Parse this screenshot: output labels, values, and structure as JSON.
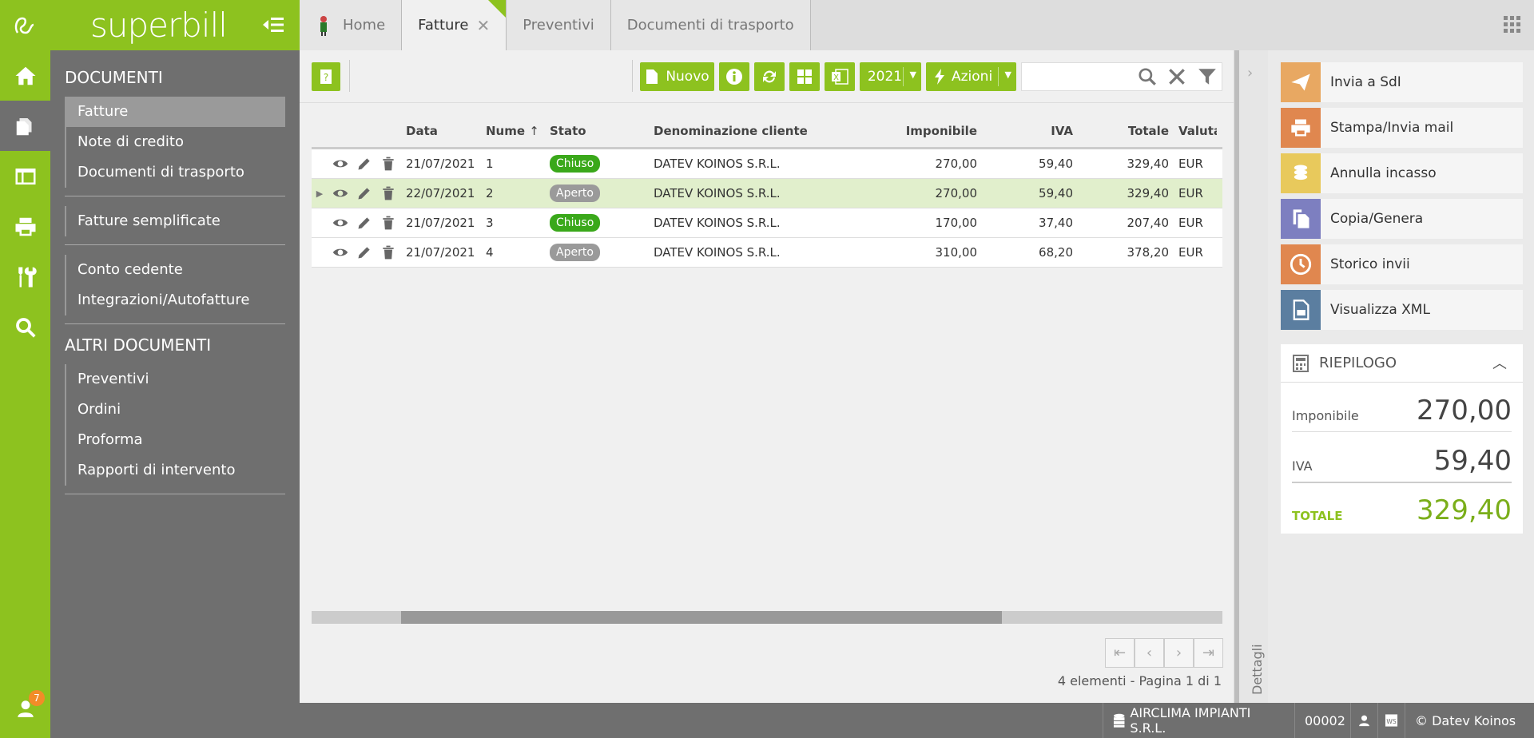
{
  "app": {
    "brand": "superbill"
  },
  "rail": {
    "items": [
      "home-icon",
      "documents-icon",
      "table-icon",
      "printer-icon",
      "tools-icon",
      "search-icon"
    ],
    "user_badge": "7"
  },
  "sidebar": {
    "section1_title": "DOCUMENTI",
    "group1": [
      "Fatture",
      "Note di credito",
      "Documenti di trasporto"
    ],
    "group2": [
      "Fatture semplificate"
    ],
    "group3": [
      "Conto cedente",
      "Integrazioni/Autofatture"
    ],
    "section2_title": "ALTRI DOCUMENTI",
    "group4": [
      "Preventivi",
      "Ordini",
      "Proforma",
      "Rapporti di intervento"
    ]
  },
  "tabs": [
    {
      "label": "Home"
    },
    {
      "label": "Fatture"
    },
    {
      "label": "Preventivi"
    },
    {
      "label": "Documenti di trasporto"
    }
  ],
  "toolbar": {
    "new_label": "Nuovo",
    "year_label": "2021",
    "actions_label": "Azioni",
    "search_value": ""
  },
  "grid": {
    "headers": {
      "data": "Data",
      "numero": "Nume",
      "stato": "Stato",
      "denominazione": "Denominazione cliente",
      "imponibile": "Imponibile",
      "iva": "IVA",
      "totale": "Totale",
      "valuta": "Valuta"
    },
    "rows": [
      {
        "data": "21/07/2021",
        "numero": "1",
        "stato": "Chiuso",
        "denominazione": "DATEV KOINOS S.R.L.",
        "imponibile": "270,00",
        "iva": "59,40",
        "totale": "329,40",
        "valuta": "EUR"
      },
      {
        "data": "22/07/2021",
        "numero": "2",
        "stato": "Aperto",
        "denominazione": "DATEV KOINOS S.R.L.",
        "imponibile": "270,00",
        "iva": "59,40",
        "totale": "329,40",
        "valuta": "EUR"
      },
      {
        "data": "21/07/2021",
        "numero": "3",
        "stato": "Chiuso",
        "denominazione": "DATEV KOINOS S.R.L.",
        "imponibile": "170,00",
        "iva": "37,40",
        "totale": "207,40",
        "valuta": "EUR"
      },
      {
        "data": "21/07/2021",
        "numero": "4",
        "stato": "Aperto",
        "denominazione": "DATEV KOINOS S.R.L.",
        "imponibile": "310,00",
        "iva": "68,20",
        "totale": "378,20",
        "valuta": "EUR"
      }
    ],
    "pager_info": "4 elementi - Pagina 1 di 1"
  },
  "details_label": "Dettagli",
  "actions": [
    {
      "label": "Invia a SdI",
      "color": "#e8a862"
    },
    {
      "label": "Stampa/Invia mail",
      "color": "#e0874f"
    },
    {
      "label": "Annulla incasso",
      "color": "#e8c95c"
    },
    {
      "label": "Copia/Genera",
      "color": "#7d7fc0"
    },
    {
      "label": "Storico invii",
      "color": "#e0874f"
    },
    {
      "label": "Visualizza XML",
      "color": "#5b7ea0"
    }
  ],
  "riepilogo": {
    "title": "RIEPILOGO",
    "imponibile_label": "Imponibile",
    "imponibile": "270,00",
    "iva_label": "IVA",
    "iva": "59,40",
    "totale_label": "TOTALE",
    "totale": "329,40"
  },
  "footer": {
    "company": "AIRCLIMA IMPIANTI S.R.L.",
    "code": "00002",
    "copyright": "© Datev Koinos"
  },
  "colors": {
    "brand_green": "#8dc21f",
    "sidebar_grey": "#6f6f6f"
  }
}
